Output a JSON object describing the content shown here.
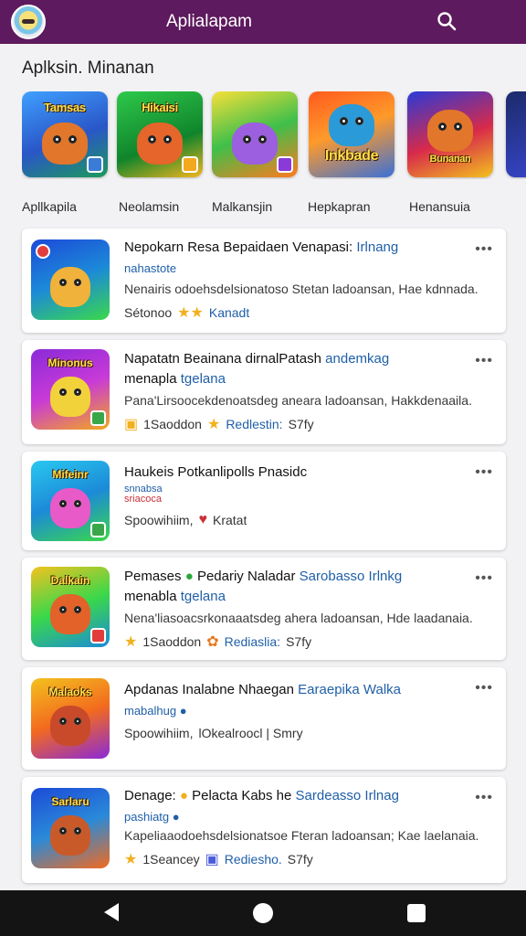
{
  "appbar": {
    "title": "Aplialapam",
    "search_icon": "search-icon",
    "avatar_icon": "cat-avatar-icon",
    "color": "#5e1a5e"
  },
  "section": {
    "title": "Aplksin. Minanan"
  },
  "featured": [
    {
      "label": "Tamsas"
    },
    {
      "label": "Hikaisi"
    },
    {
      "label": ""
    },
    {
      "label": "Inkbade"
    },
    {
      "label": "Bunanan"
    }
  ],
  "categories": [
    "Apllkapila",
    "Neolamsin",
    "Malkansjin",
    "Hepkapran",
    "Henansuia"
  ],
  "cards": [
    {
      "title": "Nepokarn Resa Bepaidaen Venapasi:",
      "tag": "Irlnang",
      "subtitle": "nahastote",
      "description": "Nenairis odoehsdelsionatoso Stetan ladoansan, Hae kdnnada.",
      "meta_left": "Sétonoo",
      "meta_link": "Kanadt",
      "icon_banner": ""
    },
    {
      "title": "Napatatn Beainana dirnalPatash",
      "tag": "andemkag",
      "subtitle": "menapla",
      "subtitle_tag": "tgelana",
      "description": "Pana'Lirsoocekdenoatsdeg aneara ladoansan, Hakkdenaaila.",
      "meta_left": "1Saoddon",
      "meta_link": "Redlestin:",
      "meta_right": "S7fy",
      "icon_banner": "Minonus"
    },
    {
      "title": "Haukeis Potkanlipolls Pnasidc",
      "tag": "",
      "subtitle": "snnabsa",
      "subtitle_tag": "sriacoca",
      "description": "",
      "meta_left": "Spoowihiim,",
      "meta_link": "",
      "meta_right": "Kratat",
      "icon_banner": "Mifeinr"
    },
    {
      "title": "Pemases",
      "title_mid": "Pedariy Naladar",
      "tag": "Sarobasso Irlnkg",
      "subtitle": "menabla",
      "subtitle_tag": "tgelana",
      "description": "Nena'liasoacsrkonaaatsdeg ahera ladoansan, Hde laadanaia.",
      "meta_left": "1Saoddon",
      "meta_link": "Rediaslia:",
      "meta_right": "S7fy",
      "icon_banner": "Dalkain"
    },
    {
      "title": "Apdanas Inalabne Nhaegan",
      "tag": "Earaepika Walka",
      "subtitle": "mabalhug",
      "description": "",
      "meta_left": "Spoowihiim,",
      "meta_link": "",
      "meta_right": "lOkealroocl | Smry",
      "icon_banner": "Malaoks"
    },
    {
      "title": "Denage:",
      "title_mid": "Pelacta Kabs he",
      "tag": "Sardeasso Irlnag",
      "subtitle": "pashiatg",
      "description": "Kapeliaaodoehsdelsionatsoe Fteran ladoansan; Kae laelanaia.",
      "meta_left": "1Seancey",
      "meta_link": "Rediesho.",
      "meta_right": "S7fy",
      "icon_banner": "Sarlaru"
    }
  ]
}
